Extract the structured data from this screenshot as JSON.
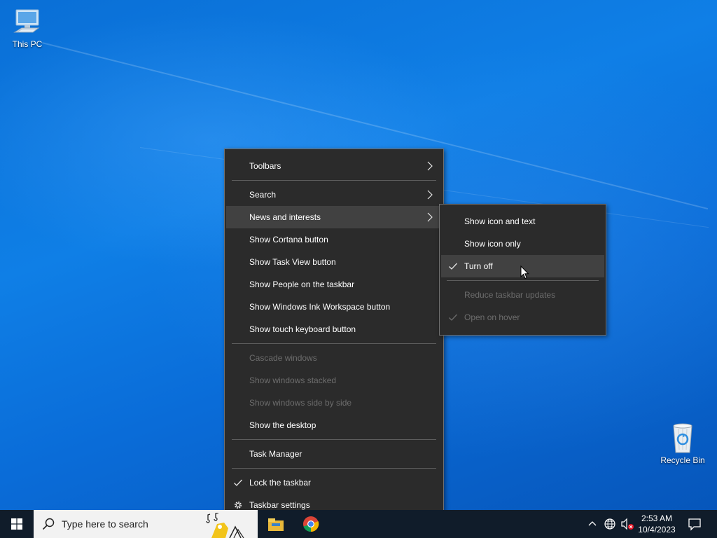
{
  "desktop": {
    "icons": [
      {
        "label": "This PC"
      },
      {
        "label": "Recycle Bin"
      }
    ]
  },
  "context_menu": {
    "items": {
      "toolbars": "Toolbars",
      "search": "Search",
      "news": "News and interests",
      "cortana": "Show Cortana button",
      "taskview": "Show Task View button",
      "people": "Show People on the taskbar",
      "ink": "Show Windows Ink Workspace button",
      "keyboard": "Show touch keyboard button",
      "cascade": "Cascade windows",
      "stacked": "Show windows stacked",
      "sidebyside": "Show windows side by side",
      "desktop": "Show the desktop",
      "taskmgr": "Task Manager",
      "lock": "Lock the taskbar",
      "settings": "Taskbar settings"
    }
  },
  "submenu": {
    "items": {
      "icon_text": "Show icon and text",
      "icon_only": "Show icon only",
      "turn_off": "Turn off",
      "reduce": "Reduce taskbar updates",
      "hover": "Open on hover"
    }
  },
  "taskbar": {
    "search_placeholder": "Type here to search",
    "time": "2:53 AM",
    "date": "10/4/2023"
  },
  "colors": {
    "menu_bg": "#2b2b2b",
    "menu_hover": "#414141",
    "disabled_text": "#6d6d6d",
    "taskbar_bg": "#101c2a"
  }
}
